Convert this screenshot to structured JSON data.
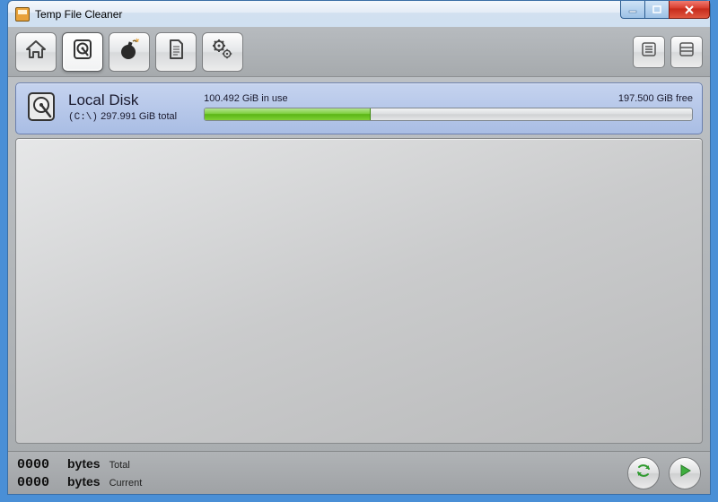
{
  "window": {
    "title": "Temp File Cleaner"
  },
  "toolbar": {
    "home": "home",
    "disk": "disk",
    "bomb": "bomb",
    "report": "report",
    "settings": "settings",
    "list": "list",
    "panel": "panel"
  },
  "disk": {
    "name": "Local Disk",
    "drive": "(C:\\)",
    "total": "297.991 GiB total",
    "used_label": "100.492 GiB in use",
    "free_label": "197.500 GiB free",
    "used_percent": 34
  },
  "status": {
    "total_value": "0000",
    "total_unit": "bytes",
    "total_label": "Total",
    "current_value": "0000",
    "current_unit": "bytes",
    "current_label": "Current"
  }
}
